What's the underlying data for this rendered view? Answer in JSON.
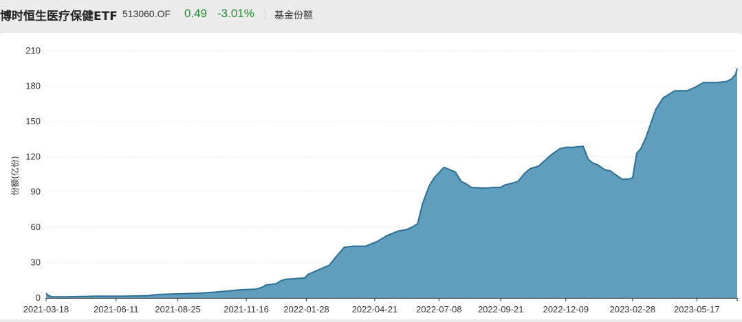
{
  "header": {
    "fund_name": "博时恒生医疗保健ETF",
    "fund_code": "513060.OF",
    "price": "0.49",
    "change_pct": "-3.01%",
    "metric_label": "基金份额",
    "up_color": "#1f8a2e"
  },
  "chart_data": {
    "type": "area",
    "title": "",
    "xlabel": "",
    "ylabel": "份额(亿份)",
    "ylim": [
      0,
      210
    ],
    "yticks": [
      0,
      30,
      60,
      90,
      120,
      150,
      180,
      210
    ],
    "xlim": [
      "2021-03-18",
      "2023-07-05"
    ],
    "xticks": [
      "2021-03-18",
      "2021-06-11",
      "2021-08-25",
      "2021-11-16",
      "2022-01-28",
      "2022-04-21",
      "2022-07-08",
      "2022-09-21",
      "2022-12-09",
      "2023-02-28",
      "2023-05-17"
    ],
    "grid": "horizontal",
    "fill_color": "#5f9ebd",
    "line_color": "#2a6f96",
    "series": [
      {
        "x": [
          "2021-03-18",
          "2021-03-21",
          "2021-03-26",
          "2021-04-10",
          "2021-05-15",
          "2021-06-20",
          "2021-07-20",
          "2021-08-01",
          "2021-08-25",
          "2021-09-20",
          "2021-10-10",
          "2021-10-25",
          "2021-11-10",
          "2021-11-28",
          "2021-12-05",
          "2021-12-10",
          "2021-12-22",
          "2021-12-29",
          "2022-01-04",
          "2022-01-26",
          "2022-01-30",
          "2022-02-12",
          "2022-02-25",
          "2022-03-05",
          "2022-03-15",
          "2022-03-25",
          "2022-04-10",
          "2022-04-24",
          "2022-05-06",
          "2022-05-20",
          "2022-05-29",
          "2022-06-05",
          "2022-06-12",
          "2022-06-18",
          "2022-06-26",
          "2022-07-02",
          "2022-07-14",
          "2022-07-28",
          "2022-08-04",
          "2022-08-10",
          "2022-08-16",
          "2022-08-29",
          "2022-09-05",
          "2022-09-12",
          "2022-09-21",
          "2022-09-26",
          "2022-10-02",
          "2022-10-12",
          "2022-10-20",
          "2022-10-27",
          "2022-11-06",
          "2022-11-20",
          "2022-12-02",
          "2022-12-09",
          "2022-12-18",
          "2022-12-30",
          "2023-01-05",
          "2023-01-10",
          "2023-01-17",
          "2023-01-25",
          "2023-02-01",
          "2023-02-15",
          "2023-02-22",
          "2023-02-28",
          "2023-03-05",
          "2023-03-10",
          "2023-03-16",
          "2023-03-28",
          "2023-04-06",
          "2023-04-20",
          "2023-05-05",
          "2023-05-15",
          "2023-05-25",
          "2023-06-10",
          "2023-06-22",
          "2023-06-28",
          "2023-07-03",
          "2023-07-05"
        ],
        "y": [
          4,
          2,
          1,
          1,
          1.5,
          1.5,
          2,
          3,
          3.5,
          4,
          5,
          6,
          7,
          7.5,
          9,
          11,
          12,
          15,
          16,
          17,
          20,
          24,
          28,
          35,
          43,
          44,
          44,
          48,
          53,
          57,
          58,
          60,
          63,
          80,
          95,
          102,
          111,
          107,
          99,
          97,
          94,
          93.5,
          93.5,
          94,
          94,
          96,
          97,
          99,
          106,
          110,
          112,
          121,
          127,
          128,
          128,
          129,
          118,
          115,
          113,
          109,
          108,
          101,
          101,
          102,
          123,
          127,
          136,
          160,
          170,
          176,
          176,
          179,
          183,
          183,
          184,
          186,
          190,
          195
        ]
      }
    ]
  }
}
